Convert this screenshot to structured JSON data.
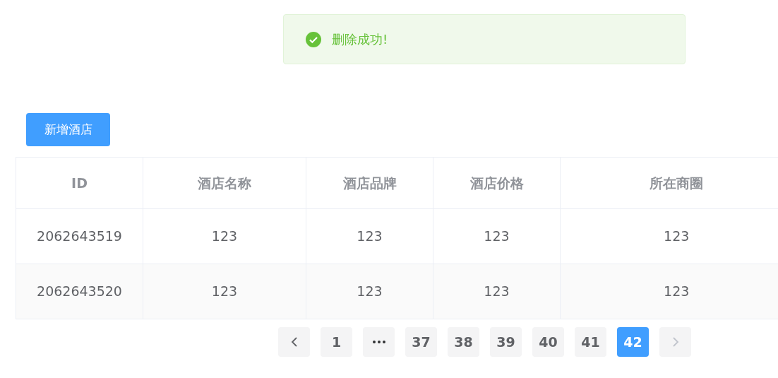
{
  "toast": {
    "kind": "success",
    "message": "删除成功!"
  },
  "add_button": "新增酒店",
  "table": {
    "columns": [
      "ID",
      "酒店名称",
      "酒店品牌",
      "酒店价格",
      "所在商圈"
    ],
    "rows": [
      [
        "2062643519",
        "123",
        "123",
        "123",
        "123"
      ],
      [
        "2062643520",
        "123",
        "123",
        "123",
        "123"
      ]
    ]
  },
  "pagination": {
    "prev_disabled": false,
    "next_disabled": true,
    "pages": [
      {
        "kind": "page",
        "label": "1",
        "selected": false
      },
      {
        "kind": "more"
      },
      {
        "kind": "page",
        "label": "37",
        "selected": false
      },
      {
        "kind": "page",
        "label": "38",
        "selected": false
      },
      {
        "kind": "page",
        "label": "39",
        "selected": false
      },
      {
        "kind": "page",
        "label": "40",
        "selected": false
      },
      {
        "kind": "page",
        "label": "41",
        "selected": false
      },
      {
        "kind": "page",
        "label": "42",
        "selected": true
      }
    ]
  }
}
